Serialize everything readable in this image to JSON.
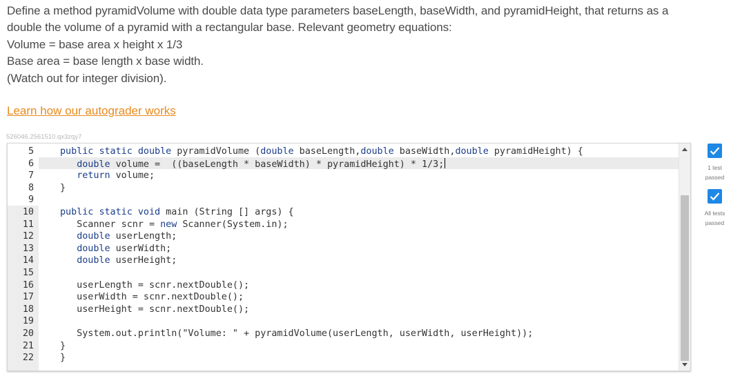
{
  "prompt": {
    "lines": [
      "Define a method pyramidVolume with double data type parameters baseLength, baseWidth, and pyramidHeight, that returns as a",
      "double the volume of a pyramid with a rectangular base. Relevant geometry equations:",
      "Volume = base area x height x 1/3",
      "Base area = base length x base width.",
      "(Watch out for integer division)."
    ]
  },
  "learn_link": "Learn how our autograder works",
  "code_id": "526046.2561510.qx3zqy7",
  "editor": {
    "lines": [
      {
        "num": "5",
        "pre": "public static double pyramidVolume (double baseLength,double baseWidth,double pyramidHeight) {"
      },
      {
        "num": "6",
        "pre": "   double volume =  ((baseLength * baseWidth) * pyramidHeight) * 1/3;"
      },
      {
        "num": "7",
        "pre": "   return volume;"
      },
      {
        "num": "8",
        "pre": "}"
      },
      {
        "num": "9",
        "pre": ""
      },
      {
        "num": "10",
        "pre": "public static void main (String [] args) {"
      },
      {
        "num": "11",
        "pre": "   Scanner scnr = new Scanner(System.in);"
      },
      {
        "num": "12",
        "pre": "   double userLength;"
      },
      {
        "num": "13",
        "pre": "   double userWidth;"
      },
      {
        "num": "14",
        "pre": "   double userHeight;"
      },
      {
        "num": "15",
        "pre": ""
      },
      {
        "num": "16",
        "pre": "   userLength = scnr.nextDouble();"
      },
      {
        "num": "17",
        "pre": "   userWidth = scnr.nextDouble();"
      },
      {
        "num": "18",
        "pre": "   userHeight = scnr.nextDouble();"
      },
      {
        "num": "19",
        "pre": ""
      },
      {
        "num": "20",
        "pre": "   System.out.println(\"Volume: \" + pyramidVolume(userLength, userWidth, userHeight));"
      },
      {
        "num": "21",
        "pre": "}"
      },
      {
        "num": "22",
        "pre": "}"
      }
    ]
  },
  "tests": [
    {
      "label_1": "1 test",
      "label_2": "passed"
    },
    {
      "label_1": "All tests",
      "label_2": "passed"
    }
  ],
  "colors": {
    "link": "#e8891d",
    "check": "#1e88e5",
    "keyword": "#1a3e8a"
  }
}
